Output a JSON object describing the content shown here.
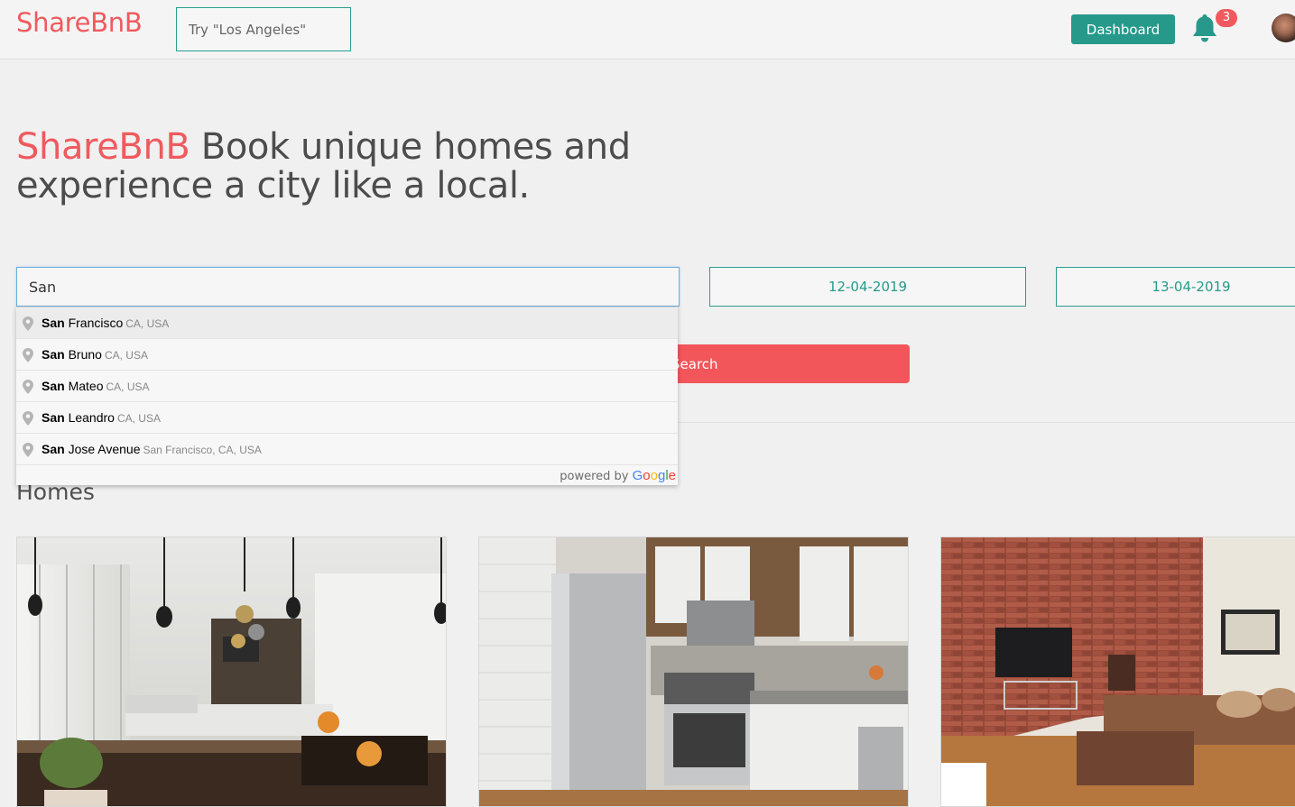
{
  "header": {
    "logo": "ShareBnB",
    "search_placeholder": "Try \"Los Angeles\"",
    "dashboard_label": "Dashboard",
    "notification_count": "3"
  },
  "hero": {
    "brand": "ShareBnB",
    "tagline": " Book unique homes and experience a city like a local."
  },
  "search": {
    "location_value": "San",
    "check_in": "12-04-2019",
    "check_out": "13-04-2019",
    "button_label": "Search"
  },
  "autocomplete": {
    "items": [
      {
        "match": "San",
        "rest": " Francisco",
        "secondary": "CA, USA"
      },
      {
        "match": "San",
        "rest": " Bruno",
        "secondary": "CA, USA"
      },
      {
        "match": "San",
        "rest": " Mateo",
        "secondary": "CA, USA"
      },
      {
        "match": "San",
        "rest": " Leandro",
        "secondary": "CA, USA"
      },
      {
        "match": "San",
        "rest": " Jose Avenue",
        "secondary": "San Francisco, CA, USA"
      }
    ],
    "powered_by": "powered by "
  },
  "homes": {
    "title": "Homes"
  },
  "colors": {
    "brand": "#f05a5e",
    "teal": "#26998a",
    "search_button": "#f2565b"
  }
}
